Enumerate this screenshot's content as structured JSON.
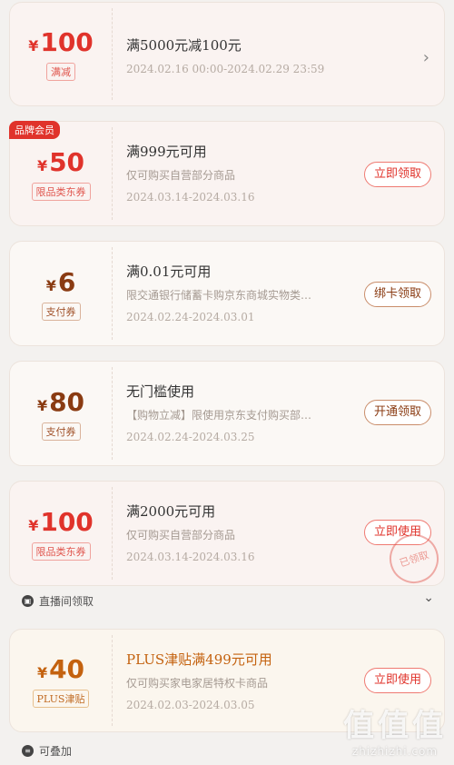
{
  "coupons": [
    {
      "amount": "100",
      "yen": "¥",
      "tag": "满减",
      "title": "满5000元减100元",
      "date": "2024.02.16 00:00-2024.02.29 23:59"
    },
    {
      "badge": "品牌会员",
      "amount": "50",
      "yen": "¥",
      "tag": "限品类东券",
      "title": "满999元可用",
      "desc": "仅可购买自营部分商品",
      "date": "2024.03.14-2024.03.16",
      "button": "立即领取"
    },
    {
      "amount": "6",
      "yen": "¥",
      "tag": "支付券",
      "title": "满0.01元可用",
      "desc": "限交通银行储蓄卡购京东商城实物类…",
      "date": "2024.02.24-2024.03.01",
      "button": "绑卡领取"
    },
    {
      "amount": "80",
      "yen": "¥",
      "tag": "支付券",
      "title": "无门槛使用",
      "desc": "【购物立减】限使用京东支付购买部…",
      "date": "2024.02.24-2024.03.25",
      "button": "开通领取"
    },
    {
      "amount": "100",
      "yen": "¥",
      "tag": "限品类东券",
      "title": "满2000元可用",
      "desc": "仅可购买自营部分商品",
      "date": "2024.03.14-2024.03.16",
      "button": "立即使用",
      "stamp": "已领取"
    },
    {
      "amount": "40",
      "yen": "¥",
      "tag": "PLUS津贴",
      "title": "PLUS津贴满499元可用",
      "desc": "仅可购买家电家居特权卡商品",
      "date": "2024.02.03-2024.03.05",
      "button": "立即使用"
    }
  ],
  "live_label": "直播间领取",
  "stack_label": "可叠加",
  "watermark": {
    "big": "值值值",
    "small": "zhizhizhi.com"
  }
}
